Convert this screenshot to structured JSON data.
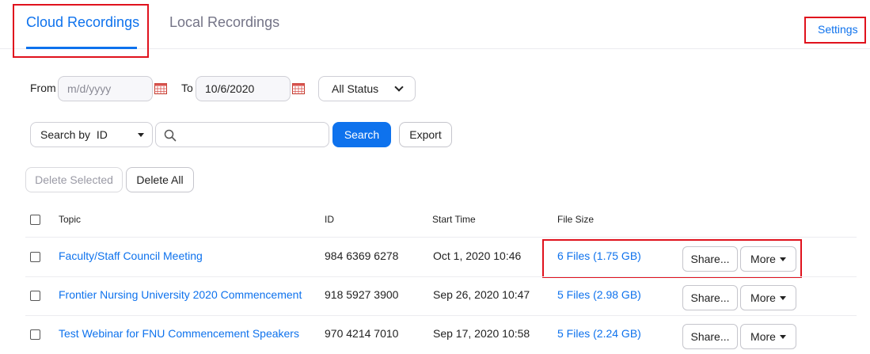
{
  "tabs": {
    "cloud": "Cloud Recordings",
    "local": "Local Recordings",
    "settings": "Settings"
  },
  "filters": {
    "from_label": "From",
    "from_placeholder": "m/d/yyyy",
    "from_value": "",
    "to_label": "To",
    "to_value": "10/6/2020",
    "status_value": "All Status"
  },
  "search": {
    "type_value": "Search by  ID",
    "query_value": "",
    "search_label": "Search",
    "export_label": "Export"
  },
  "actions": {
    "delete_selected": "Delete Selected",
    "delete_all": "Delete All"
  },
  "table": {
    "headers": {
      "topic": "Topic",
      "id": "ID",
      "start_time": "Start Time",
      "file_size": "File Size"
    },
    "rows": [
      {
        "topic": "Faculty/Staff Council Meeting",
        "id": "984 6369 6278",
        "start_time": "Oct 1, 2020 10:46",
        "file_size": "6 Files (1.75 GB)",
        "share": "Share...",
        "more": "More"
      },
      {
        "topic": "Frontier Nursing University 2020 Commencement",
        "id": "918 5927 3900",
        "start_time": "Sep 26, 2020 10:47",
        "file_size": "5 Files (2.98 GB)",
        "share": "Share...",
        "more": "More"
      },
      {
        "topic": "Test Webinar for FNU Commencement Speakers",
        "id": "970 4214 7010",
        "start_time": "Sep 17, 2020 10:58",
        "file_size": "5 Files (2.24 GB)",
        "share": "Share...",
        "more": "More"
      }
    ]
  },
  "colors": {
    "accent": "#0e72ed",
    "highlight_box": "#e0121d"
  },
  "icons": [
    "calendar-icon",
    "search-icon",
    "chevron-down-icon",
    "caret-down-icon"
  ]
}
